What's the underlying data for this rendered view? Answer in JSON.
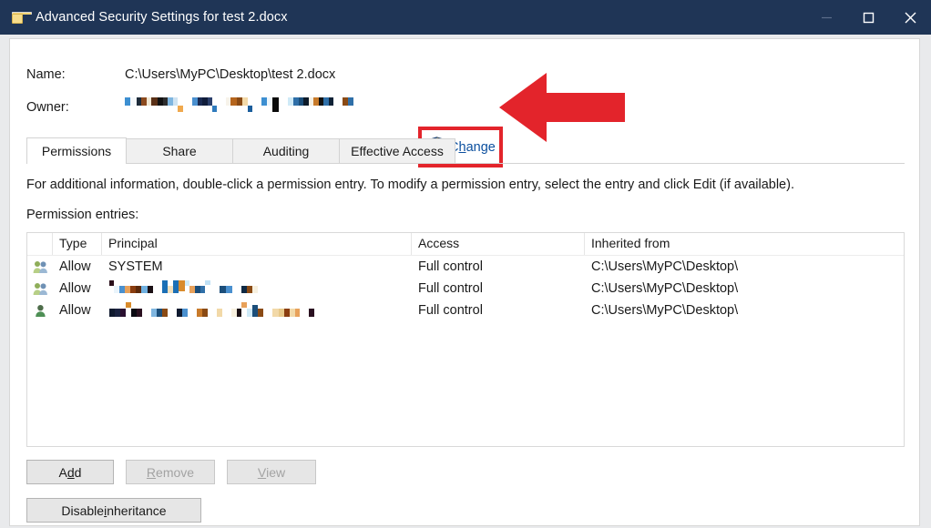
{
  "window": {
    "title": "Advanced Security Settings for test 2.docx",
    "icon": "folder-icon",
    "titlebar_color": "#1f3556",
    "controls": {
      "minimize": "minimize-icon",
      "maximize": "maximize-icon",
      "close": "close-icon"
    }
  },
  "info": {
    "name_label": "Name:",
    "name_value": "C:\\Users\\MyPC\\Desktop\\test 2.docx",
    "owner_label": "Owner:",
    "owner_value_redacted": true,
    "change_link": "Change",
    "change_link_mnemonic": "h",
    "change_icon": "uac-shield-icon"
  },
  "annotation": {
    "color": "#e3242b",
    "arrow": "left-arrow-annotation",
    "highlight_target": "change-link"
  },
  "tabs": [
    {
      "label": "Permissions",
      "active": true
    },
    {
      "label": "Share",
      "active": false
    },
    {
      "label": "Auditing",
      "active": false
    },
    {
      "label": "Effective Access",
      "active": false
    }
  ],
  "main": {
    "instruction": "For additional information, double-click a permission entry. To modify a permission entry, select the entry and click Edit (if available).",
    "entries_label": "Permission entries:"
  },
  "table": {
    "columns": [
      "",
      "Type",
      "Principal",
      "Access",
      "Inherited from"
    ],
    "rows": [
      {
        "icon": "users-group-icon",
        "type": "Allow",
        "principal": "SYSTEM",
        "principal_redacted": false,
        "access": "Full control",
        "inherited_from": "C:\\Users\\MyPC\\Desktop\\"
      },
      {
        "icon": "users-group-icon",
        "type": "Allow",
        "principal": "",
        "principal_redacted": true,
        "access": "Full control",
        "inherited_from": "C:\\Users\\MyPC\\Desktop\\"
      },
      {
        "icon": "user-icon",
        "type": "Allow",
        "principal": "",
        "principal_redacted": true,
        "access": "Full control",
        "inherited_from": "C:\\Users\\MyPC\\Desktop\\"
      }
    ]
  },
  "buttons": {
    "add": {
      "label": "Add",
      "mnemonic": "d",
      "enabled": true
    },
    "remove": {
      "label": "Remove",
      "mnemonic": "R",
      "enabled": false
    },
    "view": {
      "label": "View",
      "mnemonic": "V",
      "enabled": false
    },
    "disable_inheritance": {
      "label": "Disable inheritance",
      "mnemonic": "i",
      "enabled": true
    }
  },
  "redaction": {
    "owner_groups": [
      [
        {
          "w": 6,
          "h": 9,
          "c": "#3d8fd1",
          "t": 0
        },
        {
          "w": 7,
          "h": 9,
          "c": "#f5f8fb",
          "t": 0
        },
        {
          "w": 5,
          "h": 9,
          "c": "#1d2b3a",
          "t": 0
        },
        {
          "w": 6,
          "h": 9,
          "c": "#8c4a1e",
          "t": 0
        },
        {
          "w": 5,
          "h": 9,
          "c": "#f0e6d2",
          "t": 0
        },
        {
          "w": 7,
          "h": 9,
          "c": "#5a3017",
          "t": 0
        },
        {
          "w": 6,
          "h": 9,
          "c": "#111111",
          "t": 0
        },
        {
          "w": 5,
          "h": 9,
          "c": "#2d2d2d",
          "t": 0
        },
        {
          "w": 6,
          "h": 9,
          "c": "#7fb6e0",
          "t": 0
        },
        {
          "w": 5,
          "h": 9,
          "c": "#cfe3f2",
          "t": 0
        },
        {
          "w": 6,
          "h": 7,
          "c": "#f0a94e",
          "t": 9
        }
      ],
      [
        {
          "w": 6,
          "h": 9,
          "c": "#4a90cf",
          "t": 0
        },
        {
          "w": 5,
          "h": 9,
          "c": "#1a2a52",
          "t": 0
        },
        {
          "w": 6,
          "h": 9,
          "c": "#101c3a",
          "t": 0
        },
        {
          "w": 5,
          "h": 9,
          "c": "#2b3f6b",
          "t": 0
        },
        {
          "w": 5,
          "h": 7,
          "c": "#2f7bbd",
          "t": 9
        }
      ],
      [
        {
          "w": 5,
          "h": 9,
          "c": "#f7f3ea",
          "t": 0
        },
        {
          "w": 7,
          "h": 9,
          "c": "#b5651d",
          "t": 0
        },
        {
          "w": 6,
          "h": 9,
          "c": "#8a4a14",
          "t": 0
        },
        {
          "w": 6,
          "h": 9,
          "c": "#f3d9a8",
          "t": 0
        },
        {
          "w": 5,
          "h": 7,
          "c": "#1b5e9c",
          "t": 9
        }
      ],
      [
        {
          "w": 6,
          "h": 9,
          "c": "#3d8fd1",
          "t": 0
        },
        {
          "w": 6,
          "h": 9,
          "c": "#eef6fb",
          "t": 0
        },
        {
          "w": 7,
          "h": 16,
          "c": "#0a0a0a",
          "t": 0
        }
      ],
      [
        {
          "w": 6,
          "h": 9,
          "c": "#cfeaf7",
          "t": 0
        },
        {
          "w": 6,
          "h": 9,
          "c": "#2f6fa8",
          "t": 0
        },
        {
          "w": 5,
          "h": 9,
          "c": "#1b4e7a",
          "t": 0
        },
        {
          "w": 6,
          "h": 9,
          "c": "#0d1b2a",
          "t": 0
        },
        {
          "w": 5,
          "h": 9,
          "c": "#f5efe2",
          "t": 0
        },
        {
          "w": 6,
          "h": 9,
          "c": "#c87a2a",
          "t": 0
        },
        {
          "w": 5,
          "h": 9,
          "c": "#121212",
          "t": 0
        },
        {
          "w": 6,
          "h": 9,
          "c": "#2f6fa8",
          "t": 0
        },
        {
          "w": 5,
          "h": 9,
          "c": "#0f2236",
          "t": 0
        }
      ],
      [
        {
          "w": 6,
          "h": 9,
          "c": "#8a4a14",
          "t": 0
        },
        {
          "w": 6,
          "h": 9,
          "c": "#2f6fa8",
          "t": 0
        }
      ]
    ],
    "row2_groups": [
      [
        {
          "w": 5,
          "h": 6,
          "c": "#2a0f1a",
          "t": 0
        },
        {
          "w": 6,
          "h": 8,
          "c": "#eaf4fb",
          "t": 6
        },
        {
          "w": 6,
          "h": 8,
          "c": "#4a90cf",
          "t": 6
        },
        {
          "w": 6,
          "h": 8,
          "c": "#e8a15a",
          "t": 6
        },
        {
          "w": 6,
          "h": 8,
          "c": "#8a3d10",
          "t": 6
        },
        {
          "w": 6,
          "h": 8,
          "c": "#5c2a0c",
          "t": 6
        },
        {
          "w": 7,
          "h": 8,
          "c": "#6fb0e0",
          "t": 6
        },
        {
          "w": 6,
          "h": 8,
          "c": "#1a0f14",
          "t": 6
        }
      ],
      [
        {
          "w": 6,
          "h": 14,
          "c": "#1b6fb5",
          "t": 0
        },
        {
          "w": 6,
          "h": 8,
          "c": "#f2e0bc",
          "t": 6
        },
        {
          "w": 6,
          "h": 14,
          "c": "#1b6fb5",
          "t": 0
        },
        {
          "w": 7,
          "h": 12,
          "c": "#d98b2b",
          "t": 0
        },
        {
          "w": 5,
          "h": 6,
          "c": "#cfeaf7",
          "t": 0
        },
        {
          "w": 6,
          "h": 8,
          "c": "#e8a15a",
          "t": 6
        },
        {
          "w": 6,
          "h": 8,
          "c": "#1b4e7a",
          "t": 6
        },
        {
          "w": 5,
          "h": 8,
          "c": "#2f6fa8",
          "t": 6
        },
        {
          "w": 6,
          "h": 5,
          "c": "#bfe0f5",
          "t": 0
        }
      ],
      [
        {
          "w": 7,
          "h": 8,
          "c": "#1b4e7a",
          "t": 6
        },
        {
          "w": 7,
          "h": 8,
          "c": "#4a90cf",
          "t": 6
        }
      ],
      [
        {
          "w": 6,
          "h": 8,
          "c": "#0f2a44",
          "t": 6
        },
        {
          "w": 6,
          "h": 8,
          "c": "#8a4a14",
          "t": 6
        },
        {
          "w": 6,
          "h": 8,
          "c": "#f7f0df",
          "t": 6
        }
      ]
    ],
    "row3_groups": [
      [
        {
          "w": 6,
          "h": 9,
          "c": "#101a2e",
          "t": 7
        },
        {
          "w": 6,
          "h": 9,
          "c": "#1a2240",
          "t": 7
        },
        {
          "w": 6,
          "h": 9,
          "c": "#2a1030",
          "t": 7
        },
        {
          "w": 6,
          "h": 6,
          "c": "#d98b2b",
          "t": 0
        },
        {
          "w": 6,
          "h": 9,
          "c": "#0a0a12",
          "t": 7
        },
        {
          "w": 6,
          "h": 9,
          "c": "#2a1020",
          "t": 7
        }
      ],
      [
        {
          "w": 6,
          "h": 9,
          "c": "#7fb6e0",
          "t": 7
        },
        {
          "w": 6,
          "h": 9,
          "c": "#1b4e7a",
          "t": 7
        },
        {
          "w": 6,
          "h": 9,
          "c": "#8a4a14",
          "t": 7
        }
      ],
      [
        {
          "w": 6,
          "h": 9,
          "c": "#0f1a30",
          "t": 7
        },
        {
          "w": 6,
          "h": 9,
          "c": "#4a90cf",
          "t": 7
        }
      ],
      [
        {
          "w": 6,
          "h": 9,
          "c": "#c87a2a",
          "t": 7
        },
        {
          "w": 6,
          "h": 9,
          "c": "#8a4a14",
          "t": 7
        }
      ],
      [
        {
          "w": 6,
          "h": 9,
          "c": "#f2d9a8",
          "t": 7
        }
      ],
      [
        {
          "w": 6,
          "h": 9,
          "c": "#f7f0df",
          "t": 7
        },
        {
          "w": 5,
          "h": 9,
          "c": "#1a0f14",
          "t": 7
        },
        {
          "w": 6,
          "h": 6,
          "c": "#e8a15a",
          "t": 0
        },
        {
          "w": 6,
          "h": 9,
          "c": "#cfeaf7",
          "t": 7
        },
        {
          "w": 6,
          "h": 13,
          "c": "#1b4e7a",
          "t": 3
        },
        {
          "w": 6,
          "h": 9,
          "c": "#8a4a14",
          "t": 7
        }
      ],
      [
        {
          "w": 7,
          "h": 9,
          "c": "#f2d9a8",
          "t": 7
        },
        {
          "w": 6,
          "h": 9,
          "c": "#e8c98a",
          "t": 7
        },
        {
          "w": 6,
          "h": 9,
          "c": "#8a3d10",
          "t": 7
        },
        {
          "w": 6,
          "h": 9,
          "c": "#f2d9a8",
          "t": 7
        },
        {
          "w": 5,
          "h": 9,
          "c": "#e8a15a",
          "t": 7
        }
      ],
      [
        {
          "w": 6,
          "h": 9,
          "c": "#2a1020",
          "t": 7
        }
      ]
    ]
  }
}
